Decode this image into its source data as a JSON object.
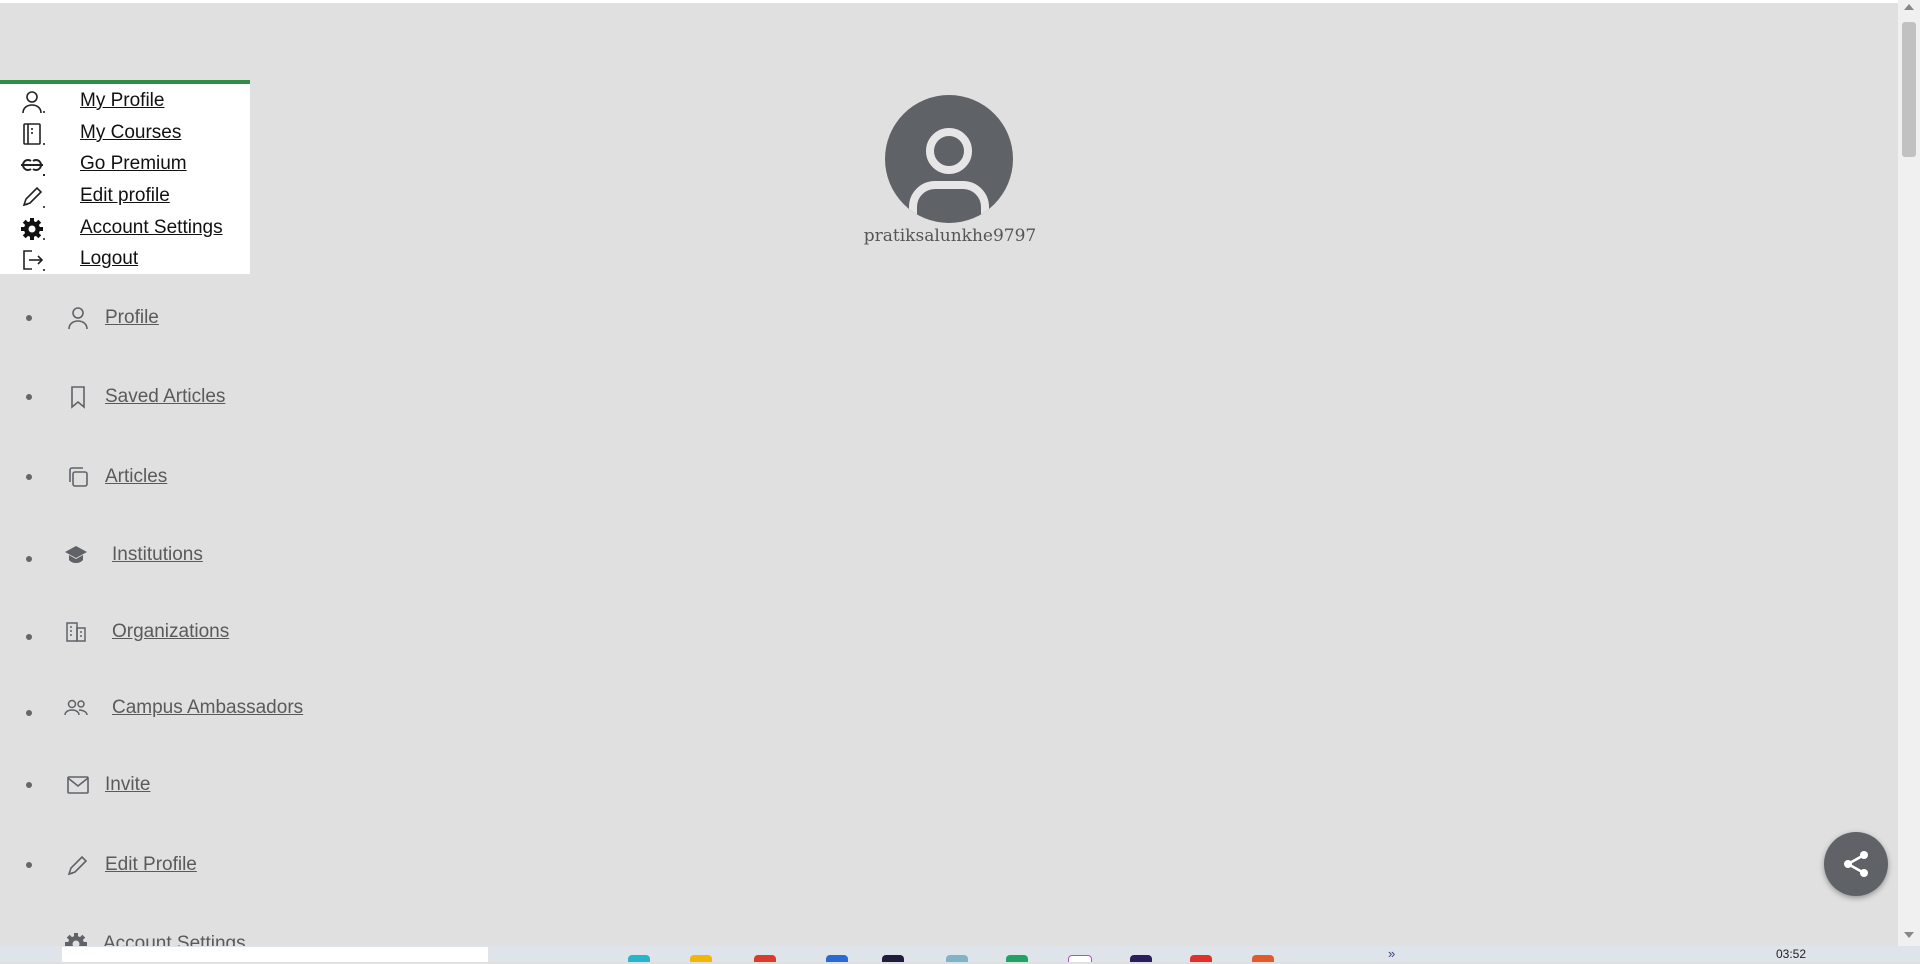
{
  "dropdown": {
    "items": [
      {
        "label": "My Profile",
        "icon": "person-icon"
      },
      {
        "label": "My Courses",
        "icon": "courses-book-icon"
      },
      {
        "label": "Go Premium",
        "icon": "gfg-logo-icon"
      },
      {
        "label": "Edit profile",
        "icon": "pencil-icon"
      },
      {
        "label": "Account Settings",
        "icon": "gear-icon"
      },
      {
        "label": "Logout",
        "icon": "logout-icon"
      }
    ],
    "accent": "#2f8d46"
  },
  "profile": {
    "username": "pratiksalunkhe9797"
  },
  "sidebar": {
    "items": [
      {
        "label": "Profile",
        "icon": "person-icon"
      },
      {
        "label": "Saved Articles",
        "icon": "bookmark-icon"
      },
      {
        "label": "Articles",
        "icon": "copy-icon"
      },
      {
        "label": "Institutions",
        "icon": "graduation-cap-icon"
      },
      {
        "label": "Organizations",
        "icon": "building-icon"
      },
      {
        "label": "Campus Ambassadors",
        "icon": "people-icon"
      },
      {
        "label": "Invite",
        "icon": "mail-icon"
      },
      {
        "label": "Edit Profile",
        "icon": "pencil-icon"
      },
      {
        "label": "Account Settings",
        "icon": "gear-icon"
      }
    ]
  },
  "taskbar": {
    "clock": "03:52",
    "overflow_glyph": "»"
  },
  "colors": {
    "background": "#e0e0e0",
    "icon_gray": "#5f6368"
  }
}
